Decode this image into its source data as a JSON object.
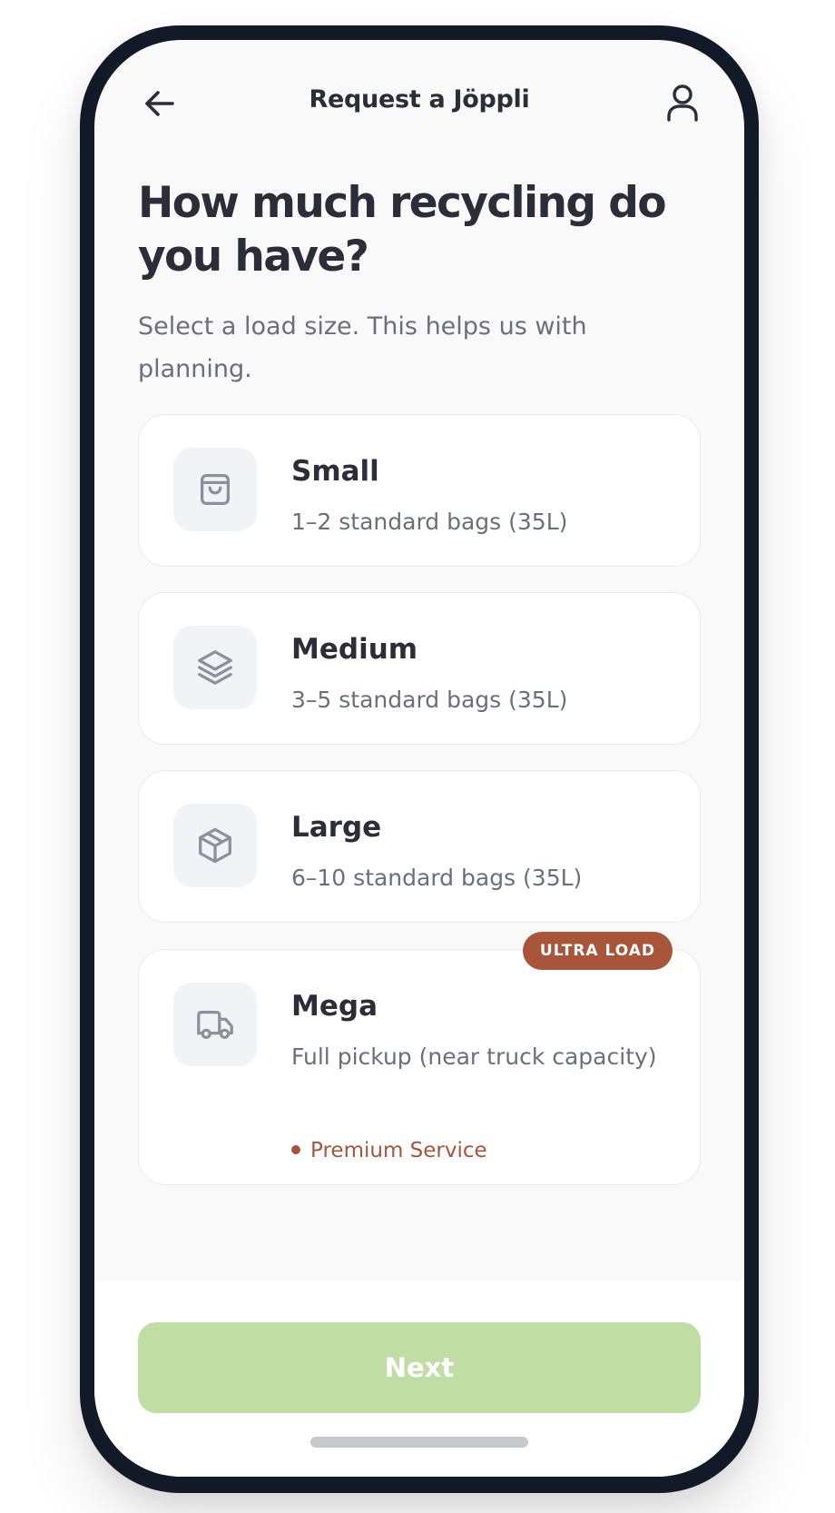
{
  "header": {
    "title": "Request a Jöppli"
  },
  "headline": "How much recycling do you have?",
  "subtitle": "Select a load size. This helps us with planning.",
  "options": [
    {
      "title": "Small",
      "description": "1–2 standard bags (35L)",
      "icon": "shopping-bag-icon"
    },
    {
      "title": "Medium",
      "description": "3–5 standard bags (35L)",
      "icon": "layers-icon"
    },
    {
      "title": "Large",
      "description": "6–10 standard bags (35L)",
      "icon": "box-icon"
    },
    {
      "title": "Mega",
      "description": "Full pickup (near truck capacity)",
      "icon": "truck-icon",
      "badge": "ULTRA LOAD",
      "note": "Premium Service"
    }
  ],
  "footer": {
    "next_label": "Next"
  },
  "colors": {
    "accent": "#a9553a",
    "next_button_disabled": "#c0dda4",
    "text_primary": "#2b2d38",
    "text_secondary": "#6a6f7c"
  }
}
